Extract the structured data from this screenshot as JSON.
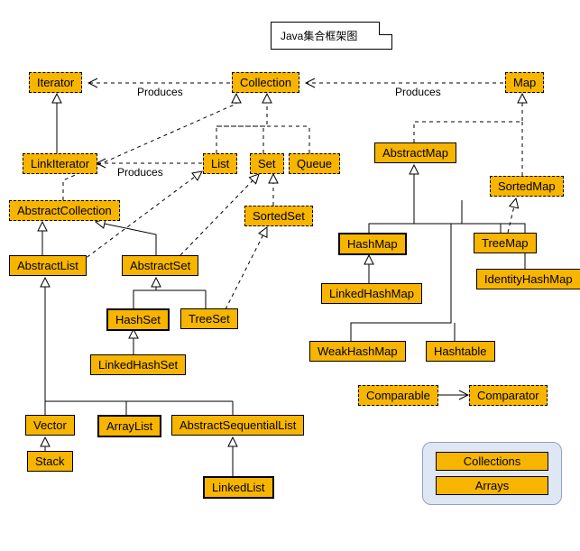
{
  "title": "Java集合框架图",
  "nodes": {
    "iterator": "Iterator",
    "collection": "Collection",
    "map": "Map",
    "linkIterator": "LinkIterator",
    "list": "List",
    "set": "Set",
    "queue": "Queue",
    "abstractMap": "AbstractMap",
    "sortedMap": "SortedMap",
    "abstractCollection": "AbstractCollection",
    "sortedSet": "SortedSet",
    "hashMap": "HashMap",
    "treeMap": "TreeMap",
    "identityHashMap": "IdentityHashMap",
    "abstractList": "AbstractList",
    "abstractSet": "AbstractSet",
    "linkedHashMap": "LinkedHashMap",
    "hashSet": "HashSet",
    "treeSet": "TreeSet",
    "weakHashMap": "WeakHashMap",
    "hashtable": "Hashtable",
    "linkedHashSet": "LinkedHashSet",
    "comparable": "Comparable",
    "comparator": "Comparator",
    "vector": "Vector",
    "arrayList": "ArrayList",
    "abstractSequentialList": "AbstractSequentialList",
    "stack": "Stack",
    "linkedList": "LinkedList"
  },
  "edgeLabels": {
    "produces1": "Produces",
    "produces2": "Produces",
    "produces3": "Produces"
  },
  "legend": {
    "collections": "Collections",
    "arrays": "Arrays"
  },
  "chart_data": {
    "type": "diagram",
    "title": "Java集合框架图",
    "nodes": [
      {
        "id": "Iterator",
        "type": "interface"
      },
      {
        "id": "Collection",
        "type": "interface"
      },
      {
        "id": "Map",
        "type": "interface"
      },
      {
        "id": "LinkIterator",
        "type": "interface"
      },
      {
        "id": "List",
        "type": "interface"
      },
      {
        "id": "Set",
        "type": "interface"
      },
      {
        "id": "Queue",
        "type": "interface"
      },
      {
        "id": "AbstractMap",
        "type": "abstract"
      },
      {
        "id": "SortedMap",
        "type": "interface"
      },
      {
        "id": "AbstractCollection",
        "type": "abstract"
      },
      {
        "id": "SortedSet",
        "type": "interface"
      },
      {
        "id": "HashMap",
        "type": "class",
        "highlight": true
      },
      {
        "id": "TreeMap",
        "type": "class"
      },
      {
        "id": "IdentityHashMap",
        "type": "class"
      },
      {
        "id": "AbstractList",
        "type": "abstract"
      },
      {
        "id": "AbstractSet",
        "type": "abstract"
      },
      {
        "id": "LinkedHashMap",
        "type": "class"
      },
      {
        "id": "HashSet",
        "type": "class",
        "highlight": true
      },
      {
        "id": "TreeSet",
        "type": "class"
      },
      {
        "id": "WeakHashMap",
        "type": "class"
      },
      {
        "id": "Hashtable",
        "type": "class"
      },
      {
        "id": "LinkedHashSet",
        "type": "class"
      },
      {
        "id": "Comparable",
        "type": "interface"
      },
      {
        "id": "Comparator",
        "type": "interface"
      },
      {
        "id": "Vector",
        "type": "class"
      },
      {
        "id": "ArrayList",
        "type": "class",
        "highlight": true
      },
      {
        "id": "AbstractSequentialList",
        "type": "class"
      },
      {
        "id": "Stack",
        "type": "class"
      },
      {
        "id": "LinkedList",
        "type": "class",
        "highlight": true
      },
      {
        "id": "Collections",
        "type": "utility"
      },
      {
        "id": "Arrays",
        "type": "utility"
      }
    ],
    "edges": [
      {
        "from": "Collection",
        "to": "Iterator",
        "label": "Produces",
        "style": "dashed"
      },
      {
        "from": "Map",
        "to": "Collection",
        "label": "Produces",
        "style": "dashed"
      },
      {
        "from": "List",
        "to": "LinkIterator",
        "label": "Produces",
        "style": "dashed"
      },
      {
        "from": "LinkIterator",
        "to": "Iterator",
        "style": "hollow"
      },
      {
        "from": "List",
        "to": "Collection",
        "style": "dashed-hollow"
      },
      {
        "from": "Set",
        "to": "Collection",
        "style": "dashed-hollow"
      },
      {
        "from": "Queue",
        "to": "Collection",
        "style": "dashed-hollow"
      },
      {
        "from": "AbstractMap",
        "to": "Map",
        "style": "dashed-hollow"
      },
      {
        "from": "SortedMap",
        "to": "Map",
        "style": "dashed-hollow"
      },
      {
        "from": "AbstractCollection",
        "to": "Collection",
        "style": "dashed-hollow"
      },
      {
        "from": "SortedSet",
        "to": "Set",
        "style": "dashed-hollow"
      },
      {
        "from": "AbstractList",
        "to": "AbstractCollection",
        "style": "hollow"
      },
      {
        "from": "AbstractList",
        "to": "List",
        "style": "dashed-hollow"
      },
      {
        "from": "AbstractSet",
        "to": "AbstractCollection",
        "style": "hollow"
      },
      {
        "from": "AbstractSet",
        "to": "Set",
        "style": "dashed-hollow"
      },
      {
        "from": "HashSet",
        "to": "AbstractSet",
        "style": "hollow"
      },
      {
        "from": "TreeSet",
        "to": "AbstractSet",
        "style": "hollow"
      },
      {
        "from": "TreeSet",
        "to": "SortedSet",
        "style": "dashed-hollow"
      },
      {
        "from": "LinkedHashSet",
        "to": "HashSet",
        "style": "hollow"
      },
      {
        "from": "HashMap",
        "to": "AbstractMap",
        "style": "hollow"
      },
      {
        "from": "TreeMap",
        "to": "AbstractMap",
        "style": "hollow"
      },
      {
        "from": "TreeMap",
        "to": "SortedMap",
        "style": "dashed-hollow"
      },
      {
        "from": "IdentityHashMap",
        "to": "AbstractMap",
        "style": "hollow"
      },
      {
        "from": "LinkedHashMap",
        "to": "HashMap",
        "style": "hollow"
      },
      {
        "from": "WeakHashMap",
        "to": "AbstractMap",
        "style": "hollow"
      },
      {
        "from": "Hashtable",
        "to": "AbstractMap",
        "style": "hollow"
      },
      {
        "from": "Vector",
        "to": "AbstractList",
        "style": "hollow"
      },
      {
        "from": "ArrayList",
        "to": "AbstractList",
        "style": "hollow"
      },
      {
        "from": "AbstractSequentialList",
        "to": "AbstractList",
        "style": "hollow"
      },
      {
        "from": "Stack",
        "to": "Vector",
        "style": "hollow"
      },
      {
        "from": "LinkedList",
        "to": "AbstractSequentialList",
        "style": "hollow"
      },
      {
        "from": "Comparable",
        "to": "Comparator",
        "style": "double-arrow"
      }
    ]
  }
}
